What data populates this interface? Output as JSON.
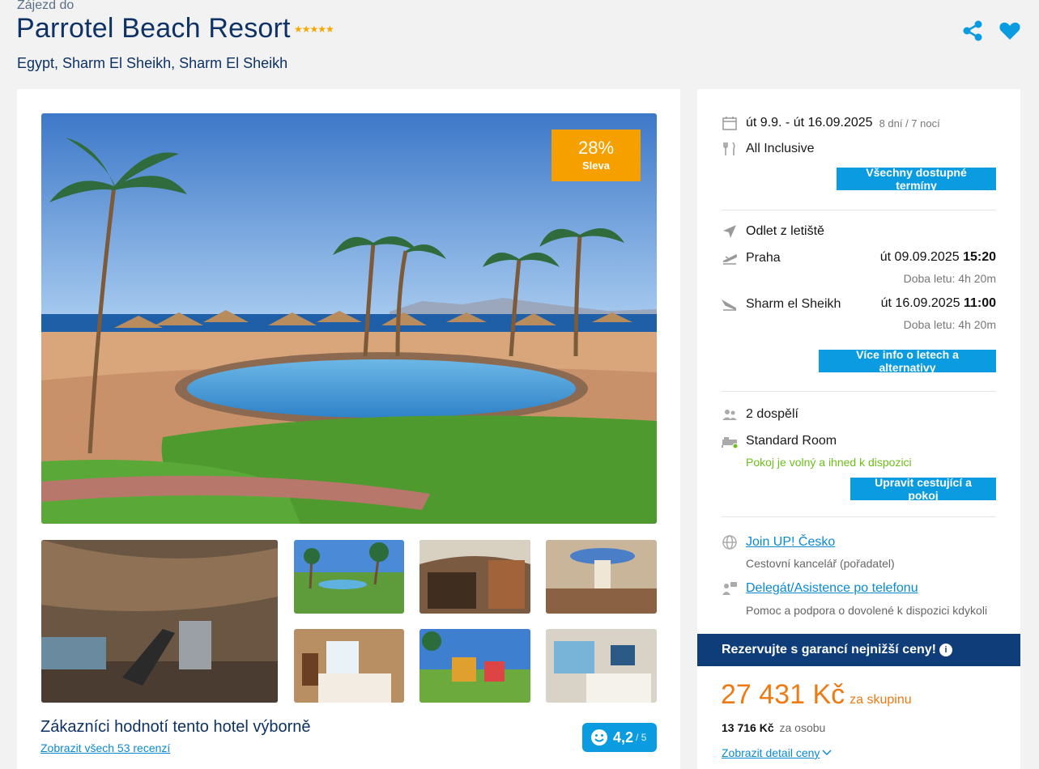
{
  "header": {
    "pre_title": "Zájezd do",
    "hotel_name": "Parrotel Beach Resort",
    "stars": "★★★★★",
    "location": "Egypt, Sharm El Sheikh, Sharm El Sheikh"
  },
  "gallery": {
    "discount_percent": "28%",
    "discount_label": "Sleva",
    "thumbnails": [
      "gym",
      "garden-pool",
      "restaurant-bar",
      "dining-hall",
      "room-bedroom",
      "playground",
      "room-sea-view"
    ]
  },
  "rating": {
    "title": "Zákazníci hodnotí tento hotel výborně",
    "reviews_link": "Zobrazit všech 53 recenzí",
    "score": "4,2",
    "score_max": "/ 5"
  },
  "booking": {
    "dates": "út 9.9. - út 16.09.2025",
    "duration": "8 dní / 7 nocí",
    "board": "All Inclusive",
    "all_dates_button": "Všechny dostupné termíny",
    "departure_heading": "Odlet z letiště",
    "outbound": {
      "city": "Praha",
      "date": "út 09.09.2025",
      "time": "15:20",
      "flight_time": "Doba letu: 4h 20m"
    },
    "inbound": {
      "city": "Sharm el Sheikh",
      "date": "út 16.09.2025",
      "time": "11:00",
      "flight_time": "Doba letu: 4h 20m"
    },
    "flights_button": "Více info o letech a alternativy",
    "travellers": "2 dospělí",
    "room": "Standard Room",
    "room_status": "Pokoj je volný a ihned k dispozici",
    "edit_button": "Upravit cestující a pokoj",
    "agency_link": "Join UP! Česko",
    "agency_sub": "Cestovní kancelář (pořadatel)",
    "assist_link": "Delegát/Asistence po telefonu",
    "assist_sub": "Pomoc a podpora o dovolené k dispozici kdykoli"
  },
  "pricing": {
    "guarantee": "Rezervujte s garancí nejnižší ceny!",
    "guarantee_info": "i",
    "total": "27 431 Kč",
    "total_suffix": "za skupinu",
    "per_person": "13 716 Kč",
    "per_person_suffix": "za osobu",
    "detail_link": "Zobrazit detail ceny"
  },
  "colors": {
    "brand_blue": "#0e3266",
    "accent_blue": "#0a9be0",
    "orange": "#ee7a14",
    "green": "#6cbf1a"
  }
}
